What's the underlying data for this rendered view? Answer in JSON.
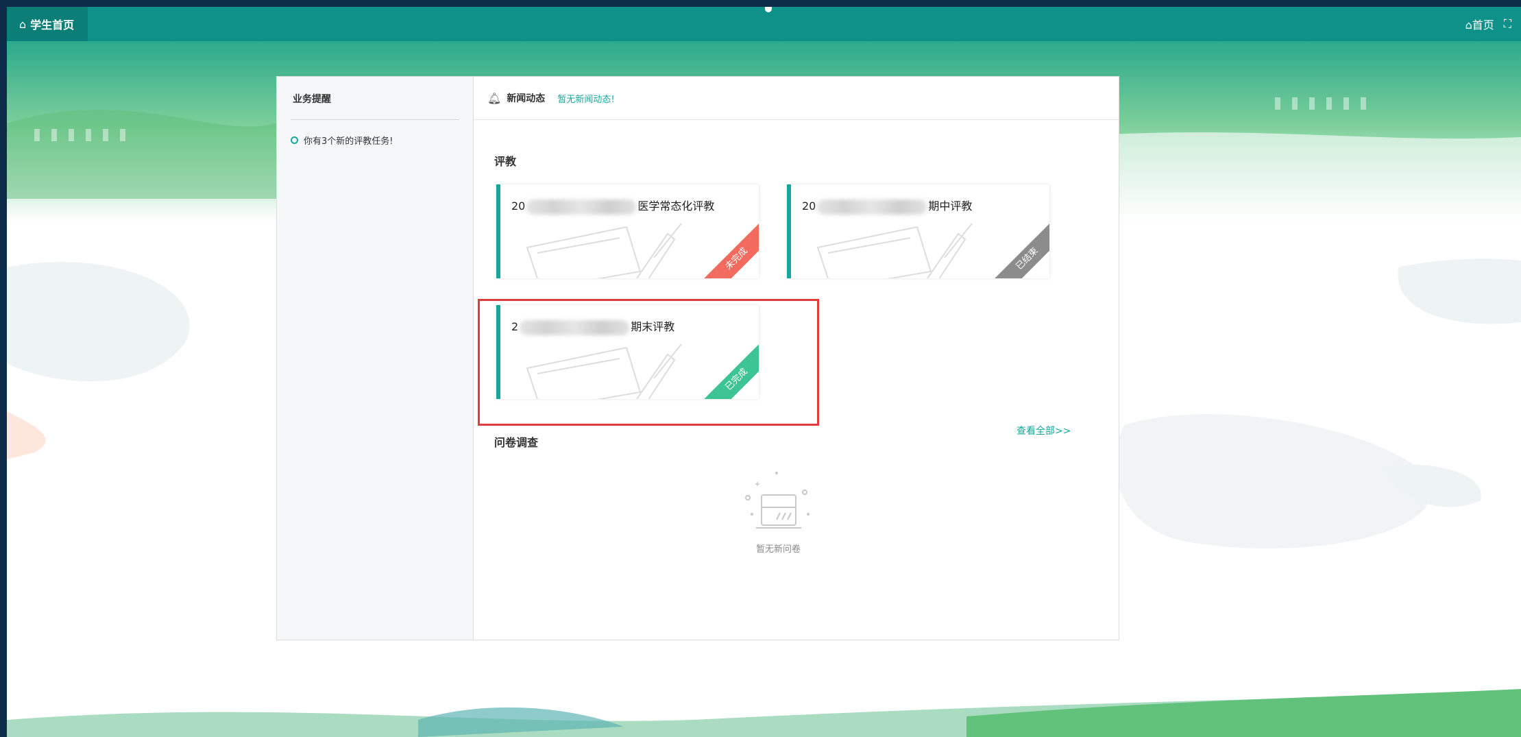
{
  "header": {
    "home_tab_label": "学生首页",
    "home_link": "首页",
    "fullscreen_glyph": "⛶"
  },
  "reminders": {
    "title": "业务提醒",
    "items": [
      "你有3个新的评教任务!"
    ]
  },
  "news": {
    "label": "新闻动态",
    "empty": "暂无新闻动态!"
  },
  "evaluation": {
    "title": "评教",
    "cards": [
      {
        "prefix": "20",
        "suffix": "医学常态化评教",
        "status": "未完成",
        "status_color": "#f26b5e"
      },
      {
        "prefix": "20",
        "suffix": "期中评教",
        "status": "已结束",
        "status_color": "#8c8c8c"
      },
      {
        "prefix": "2",
        "suffix": "期末评教",
        "status": "已完成",
        "status_color": "#3cc495"
      }
    ]
  },
  "survey": {
    "title": "问卷调查",
    "view_all": "查看全部>>",
    "empty": "暂无新问卷"
  },
  "colors": {
    "primary": "#0e9188",
    "accent": "#14a79d",
    "highlight": "#e03c3c"
  }
}
